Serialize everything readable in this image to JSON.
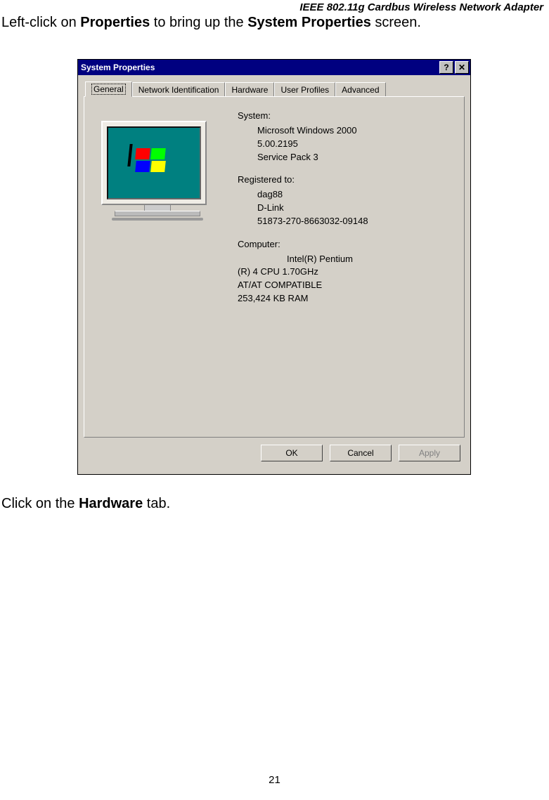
{
  "header": "IEEE 802.11g Cardbus Wireless Network Adapter",
  "instruction_pre": "Left-click on ",
  "instruction_b1": "Properties",
  "instruction_mid": " to bring up the ",
  "instruction_b2": "System Properties",
  "instruction_post": " screen.",
  "instruction2_pre": "Click on the ",
  "instruction2_b": "Hardware",
  "instruction2_post": " tab.",
  "page_number": "21",
  "dialog": {
    "title": "System Properties",
    "help_glyph": "?",
    "close_glyph": "✕",
    "tabs": {
      "general": "General",
      "netid": "Network Identification",
      "hardware": "Hardware",
      "profiles": "User Profiles",
      "advanced": "Advanced"
    },
    "system": {
      "label": "System:",
      "line1": "Microsoft Windows 2000",
      "line2": "5.00.2195",
      "line3": "Service Pack 3"
    },
    "registered": {
      "label": "Registered to:",
      "line1": "dag88",
      "line2": "D-Link",
      "line3": "51873-270-8663032-09148"
    },
    "computer": {
      "label": "Computer:",
      "line1": "Intel(R) Pentium",
      "line2": "(R) 4 CPU 1.70GHz",
      "line3": "AT/AT COMPATIBLE",
      "line4": "253,424 KB RAM"
    },
    "buttons": {
      "ok": "OK",
      "cancel": "Cancel",
      "apply": "Apply"
    }
  }
}
